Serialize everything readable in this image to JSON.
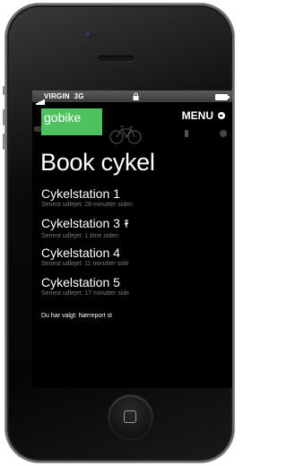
{
  "status_bar": {
    "carrier": "VIRGIN",
    "network": "3G"
  },
  "header": {
    "logo_text": "gobike",
    "menu_label": "MENU"
  },
  "main": {
    "title": "Book cykel",
    "stations": [
      {
        "name": "Cykelstation 1",
        "subtitle": "Senest udlejet: 28 minutter siden",
        "pin": false
      },
      {
        "name": "Cykelstation 3",
        "subtitle": "Senest udlejet: 1 time siden",
        "pin": true
      },
      {
        "name": "Cykelstation 4",
        "subtitle": "Senest udlejet: 11 minutter side",
        "pin": false
      },
      {
        "name": "Cykelstation 5",
        "subtitle": "Senest udlejet: 17 minutter side",
        "pin": false
      }
    ],
    "selected_text": "Du har valgt: Nørreport st"
  },
  "colors": {
    "brand_green": "#4ec25f",
    "screen_background": "#000000",
    "subtitle_gray": "#7a7a7a"
  },
  "icons": {
    "status": [
      "signal-icon",
      "lock-icon",
      "battery-icon"
    ],
    "menu": "menu-circle-icon",
    "decor": [
      "bicycle-icon",
      "pin-icon"
    ],
    "hardware": "home-button-icon"
  }
}
